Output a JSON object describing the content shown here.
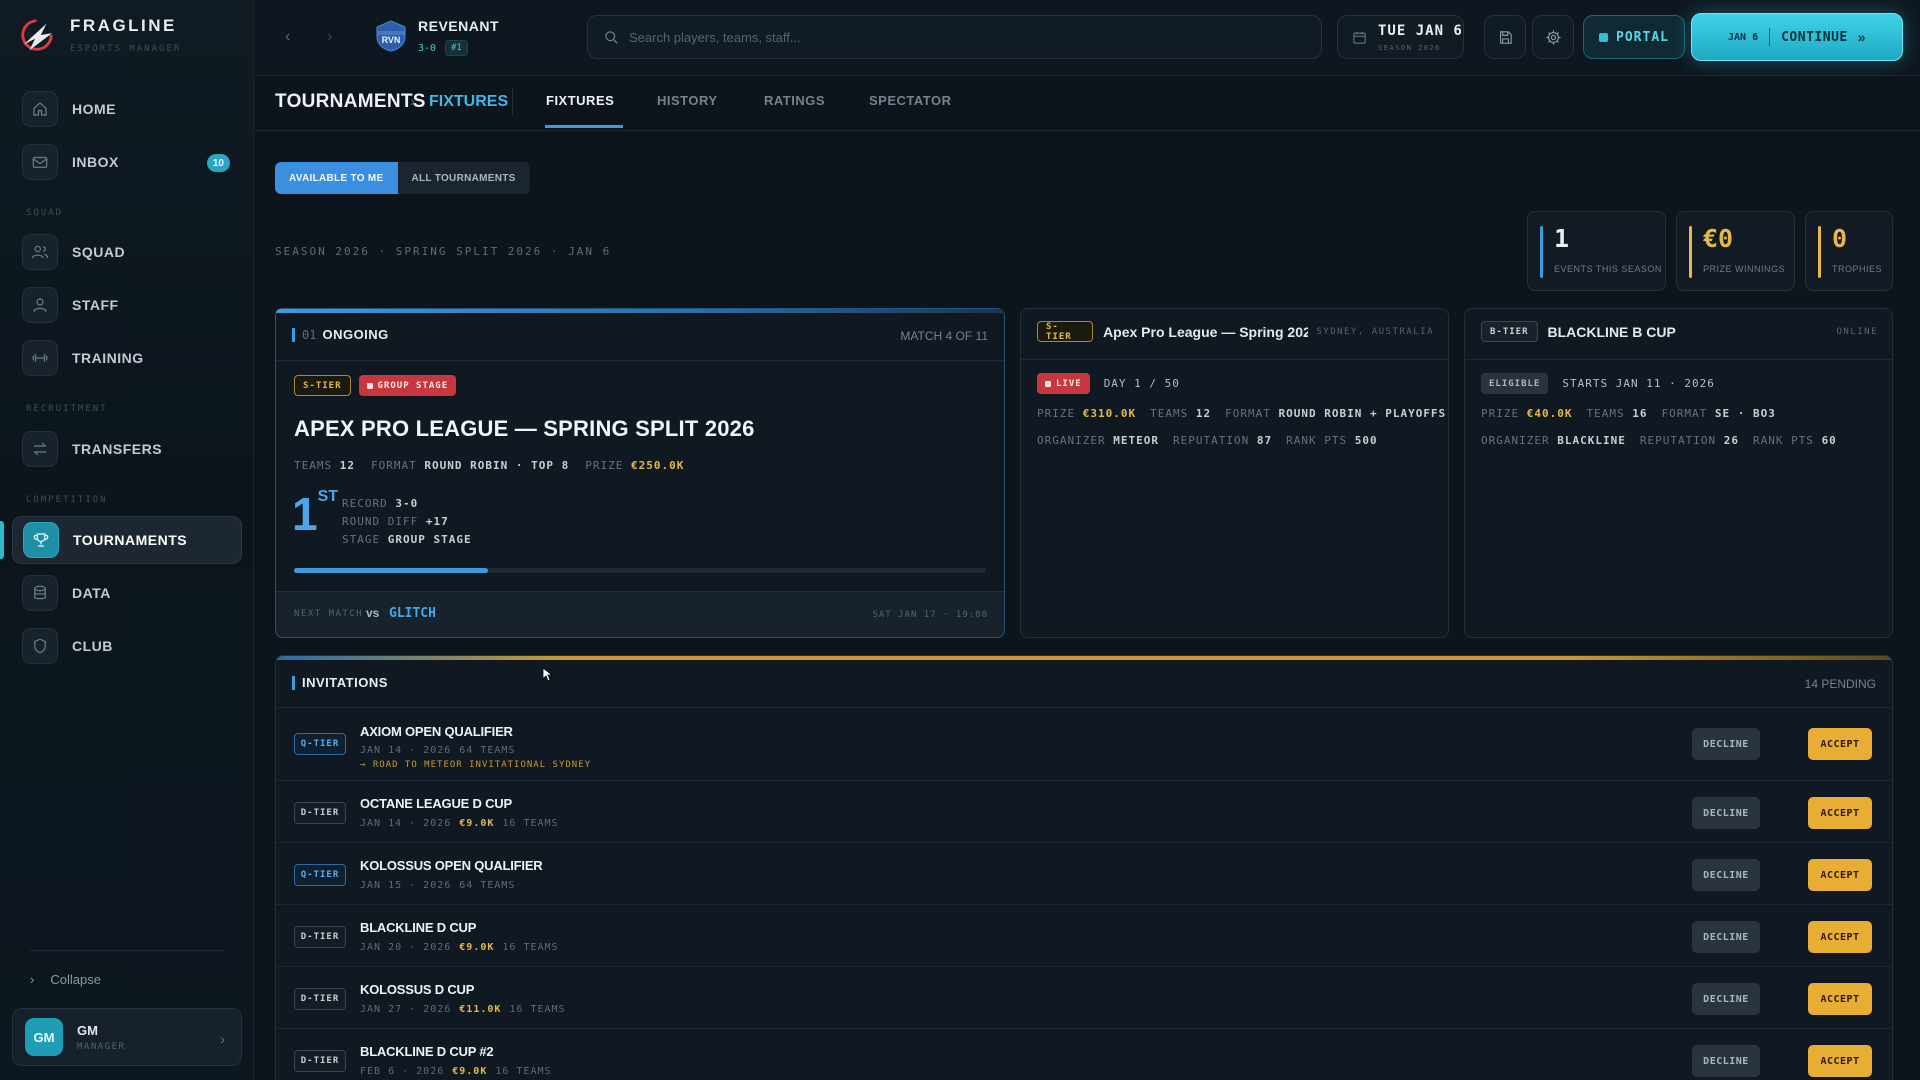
{
  "brand": {
    "name": "FRAGLINE",
    "subtitle": "ESPORTS MANAGER"
  },
  "sidebar": {
    "items": [
      {
        "label": "HOME",
        "icon": "home-icon"
      },
      {
        "label": "INBOX",
        "icon": "mail-icon",
        "badge": "10"
      },
      {
        "label": "SQUAD",
        "icon": "users-icon"
      },
      {
        "label": "STAFF",
        "icon": "user-icon"
      },
      {
        "label": "TRAINING",
        "icon": "dumbbell-icon"
      },
      {
        "label": "TRANSFERS",
        "icon": "swap-icon"
      },
      {
        "label": "TOURNAMENTS",
        "icon": "trophy-icon",
        "active": true
      },
      {
        "label": "DATA",
        "icon": "database-icon"
      },
      {
        "label": "CLUB",
        "icon": "shield-icon"
      }
    ],
    "sections": {
      "squad": "SQUAD",
      "recruitment": "RECRUITMENT",
      "competition": "COMPETITION"
    },
    "collapse_label": "Collapse",
    "user": {
      "initials": "GM",
      "name": "GM",
      "role": "MANAGER"
    }
  },
  "topbar": {
    "team": {
      "name": "REVENANT",
      "tag": "RVN",
      "record": "3-0",
      "rank": "#1"
    },
    "search_placeholder": "Search players, teams, staff...",
    "date": {
      "main": "TUE JAN 6",
      "sub": "SEASON 2026"
    },
    "portal_label": "PORTAL",
    "continue": {
      "date": "JAN 6",
      "label": "CONTINUE",
      "arrow": "»"
    }
  },
  "page": {
    "breadcrumb": {
      "root": "TOURNAMENTS",
      "sep": "›",
      "current": "FIXTURES"
    },
    "tabs": [
      "FIXTURES",
      "HISTORY",
      "RATINGS",
      "SPECTATOR"
    ],
    "filters": {
      "available": "AVAILABLE TO ME",
      "all": "ALL TOURNAMENTS"
    },
    "season_line": "SEASON 2026 · SPRING SPLIT 2026 · JAN 6",
    "stats": [
      {
        "value": "1",
        "label": "EVENTS THIS SEASON",
        "color": "#e9eef3",
        "bar": "#3d9be0"
      },
      {
        "value": "€0",
        "label": "PRIZE WINNINGS",
        "color": "#e6b84a",
        "bar": "#e6b84a"
      },
      {
        "value": "0",
        "label": "TROPHIES",
        "color": "#e6b84a",
        "bar": "#e6b84a"
      }
    ]
  },
  "ongoing": {
    "index": "01",
    "title": "ONGOING",
    "match": "MATCH 4 OF 11",
    "tier": "S-TIER",
    "stage_tag": "GROUP STAGE",
    "name": "APEX PRO LEAGUE — SPRING SPLIT 2026",
    "teams_lbl": "TEAMS",
    "teams": "12",
    "format_lbl": "FORMAT",
    "format": "ROUND ROBIN · TOP 8",
    "prize_lbl": "PRIZE",
    "prize": "€250.0K",
    "position": "1",
    "position_suffix": "ST",
    "record_lbl": "RECORD",
    "record": "3-0",
    "diff_lbl": "ROUND DIFF",
    "diff": "+17",
    "stage_lbl": "STAGE",
    "stage": "GROUP STAGE",
    "progress": 0.28,
    "next_lbl": "NEXT MATCH",
    "vs": "vs",
    "opponent": "GLITCH",
    "time": "SAT JAN 17 · 19:00"
  },
  "cards": [
    {
      "tier": "S-TIER",
      "name": "Apex Pro League — Spring 202",
      "location": "SYDNEY, AUSTRALIA",
      "status": "LIVE",
      "status_text": "DAY 1 / 50",
      "prize_lbl": "PRIZE",
      "prize": "€310.0K",
      "teams_lbl": "TEAMS",
      "teams": "12",
      "format_lbl": "FORMAT",
      "format": "ROUND ROBIN + PLAYOFFS",
      "org_lbl": "ORGANIZER",
      "org": "METEOR",
      "rep_lbl": "REPUTATION",
      "rep": "87",
      "rank_lbl": "RANK PTS",
      "rank": "500"
    },
    {
      "tier": "B-TIER",
      "name": "BLACKLINE B CUP",
      "location": "ONLINE",
      "status": "ELIGIBLE",
      "status_text": "STARTS JAN 11 · 2026",
      "prize_lbl": "PRIZE",
      "prize": "€40.0K",
      "teams_lbl": "TEAMS",
      "teams": "16",
      "format_lbl": "FORMAT",
      "format": "SE · BO3",
      "org_lbl": "ORGANIZER",
      "org": "BLACKLINE",
      "rep_lbl": "REPUTATION",
      "rep": "26",
      "rank_lbl": "RANK PTS",
      "rank": "60"
    }
  ],
  "invitations": {
    "title": "INVITATIONS",
    "count": "14 PENDING",
    "decline_label": "DECLINE",
    "accept_label": "ACCEPT",
    "rows": [
      {
        "tier": "Q-TIER",
        "name": "AXIOM OPEN QUALIFIER",
        "date": "JAN 14 · 2026",
        "prize": "",
        "teams": "64 TEAMS",
        "road": "→ ROAD TO METEOR INVITATIONAL SYDNEY"
      },
      {
        "tier": "D-TIER",
        "name": "OCTANE LEAGUE D CUP",
        "date": "JAN 14 · 2026",
        "prize": "€9.0K",
        "teams": "16 TEAMS"
      },
      {
        "tier": "Q-TIER",
        "name": "KOLOSSUS OPEN QUALIFIER",
        "date": "JAN 15 · 2026",
        "prize": "",
        "teams": "64 TEAMS"
      },
      {
        "tier": "D-TIER",
        "name": "BLACKLINE D CUP",
        "date": "JAN 20 · 2026",
        "prize": "€9.0K",
        "teams": "16 TEAMS"
      },
      {
        "tier": "D-TIER",
        "name": "KOLOSSUS D CUP",
        "date": "JAN 27 · 2026",
        "prize": "€11.0K",
        "teams": "16 TEAMS"
      },
      {
        "tier": "D-TIER",
        "name": "BLACKLINE D CUP #2",
        "date": "FEB 6 · 2026",
        "prize": "€9.0K",
        "teams": "16 TEAMS"
      }
    ]
  }
}
